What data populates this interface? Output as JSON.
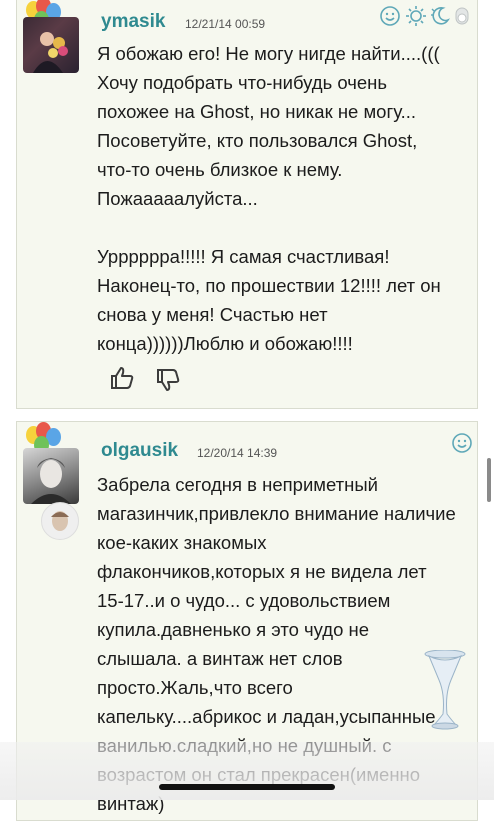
{
  "posts": [
    {
      "username": "ymasik",
      "date": "12/21/14 00:59",
      "text": "Я обожаю его! Не могу нигде найти....(((\nХочу подобрать что-нибудь очень\nпохожее на Ghost, но никак не могу...\nПосоветуйте, кто пользовался Ghost,\nчто-то очень близкое к нему.\nПожааааалуйста...\n\nУррррррa!!!!! Я самая счастливая!\nНаконец-то, по прошествии 12!!!! лет он\nснова у меня! Счастью нет\nконца))))))Люблю и обожаю!!!!"
    },
    {
      "username": "olgausik",
      "date": "12/20/14 14:39",
      "text": "Забрела сегодня в неприметный\nмагазинчик,привлекло внимание наличие\nкое-каких знакомых\nфлакончиков,которых я не видела лет\n15-17..и о чудо... с удовольствием\nкупила.давненько я это чудо не\nслышала. а винтаж нет слов\nпросто.Жаль,что всего\nкапельку....абрикос и ладан,усыпанные\nванилью.сладкий,но не душный. с\nвозрастом он стал прекрасен(именно\nвинтаж)"
    }
  ],
  "colors": {
    "card_bg": "#f6f8ef",
    "username": "#2f8a90",
    "icon": "#5fa8b8",
    "thumb_icon": "#3c3c3c"
  },
  "icons": [
    "smiley-icon",
    "sun-icon",
    "moon-icon",
    "toggle-icon",
    "thumbs-up-icon",
    "thumbs-down-icon",
    "balloons-icon",
    "perfume-bottle-icon"
  ]
}
